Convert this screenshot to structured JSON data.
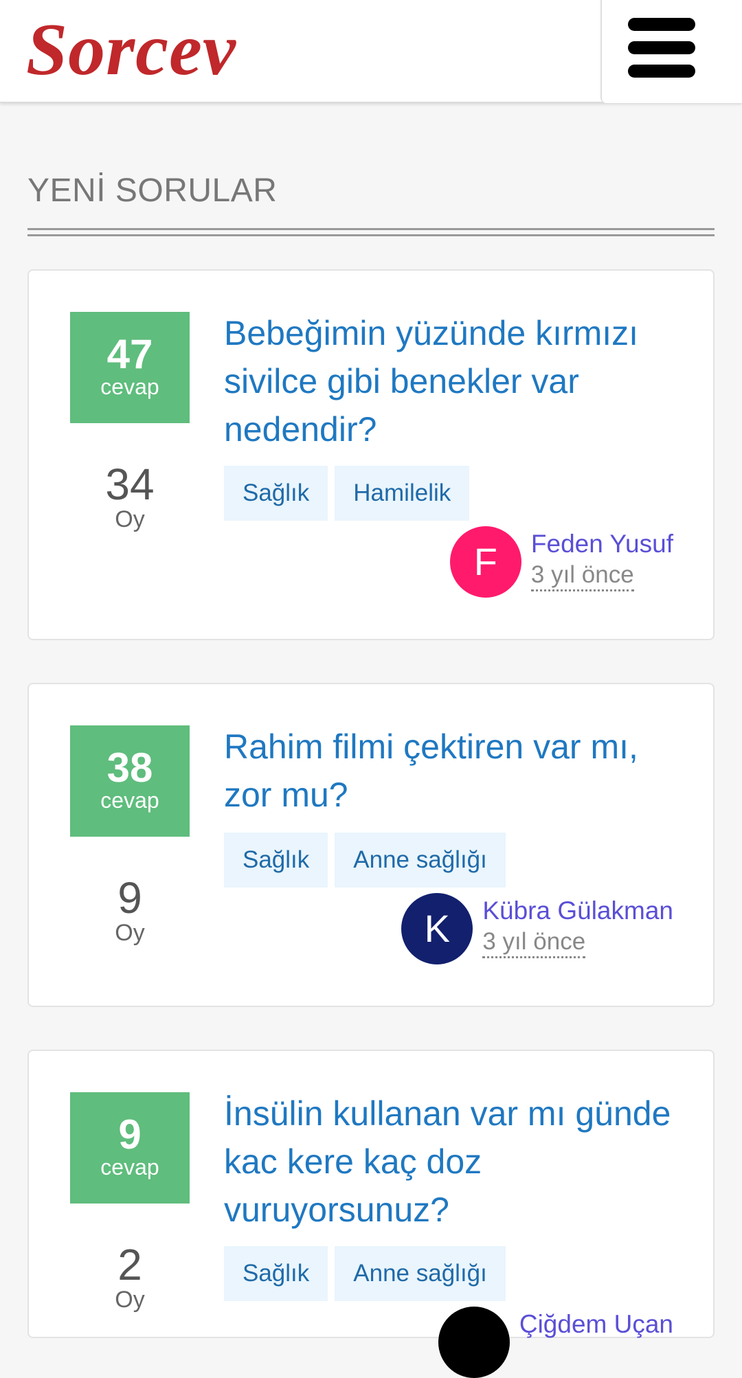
{
  "header": {
    "logo_text": "Sorcev",
    "logo_color": "#c0282b",
    "menu_icon": "hamburger-menu-icon"
  },
  "section": {
    "title": "YENİ SORULAR"
  },
  "questions": [
    {
      "answers_count": "47",
      "answers_label": "cevap",
      "votes_count": "34",
      "votes_label": "Oy",
      "title": "Bebeğimin yüzünde kırmızı sivilce gibi benekler var nedendir?",
      "tags": [
        "Sağlık",
        "Hamilelik"
      ],
      "author_initial": "F",
      "author_name": "Feden Yusuf",
      "author_avatar_color": "#ff1a6c",
      "time": "3 yıl önce"
    },
    {
      "answers_count": "38",
      "answers_label": "cevap",
      "votes_count": "9",
      "votes_label": "Oy",
      "title": "Rahim filmi çektiren var mı, zor mu?",
      "tags": [
        "Sağlık",
        "Anne sağlığı"
      ],
      "author_initial": "K",
      "author_name": "Kübra Gülakman",
      "author_avatar_color": "#12206e",
      "time": "3 yıl önce"
    },
    {
      "answers_count": "9",
      "answers_label": "cevap",
      "votes_count": "2",
      "votes_label": "Oy",
      "title": "İnsülin kullanan var mı günde kac kere kaç doz vuruyorsunuz?",
      "tags": [
        "Sağlık",
        "Anne sağlığı"
      ],
      "author_initial": "",
      "author_name": "Çiğdem Uçan",
      "author_avatar_color": "#000000",
      "time": ""
    }
  ],
  "colors": {
    "answers_box": "#5fbd7d",
    "title_link": "#1f78c1",
    "tag_bg": "#eaf5fd",
    "author_link": "#5a4fd6"
  }
}
